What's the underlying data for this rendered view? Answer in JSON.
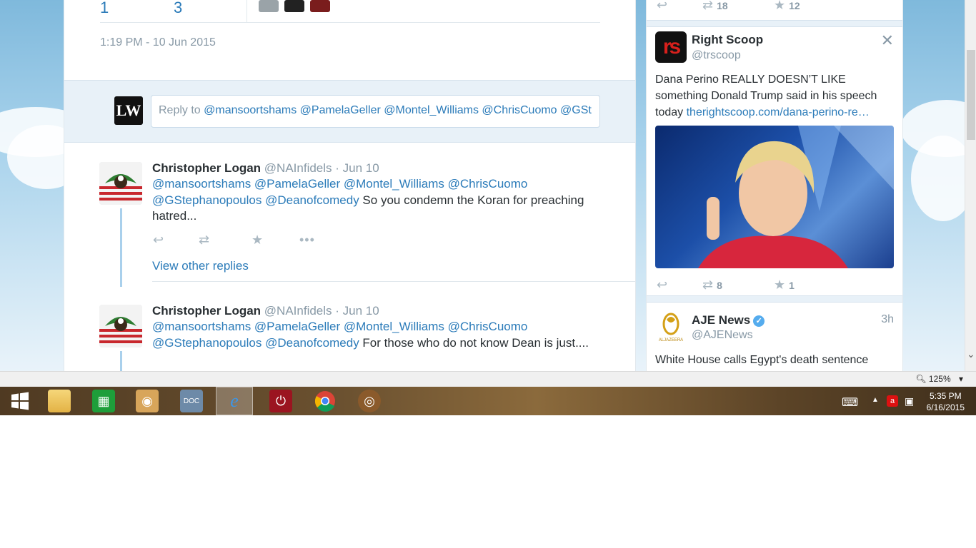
{
  "tweet_detail": {
    "counts": {
      "first": "1",
      "second": "3"
    },
    "timestamp": "1:19 PM - 10 Jun 2015"
  },
  "reply": {
    "avatar_text": "LW",
    "prefix": "Reply to ",
    "mentions": "@mansoortshams @PamelaGeller @Montel_Williams @ChrisCuomo @GSt"
  },
  "replies": [
    {
      "name": "Christopher Logan",
      "handle": "@NAInfidels",
      "date": "· Jun 10",
      "mentions_line1": "@mansoortshams @PamelaGeller @Montel_Williams @ChrisCuomo",
      "mentions_line2": "@GStephanopoulos @Deanofcomedy",
      "text": " So you condemn the Koran for preaching hatred...",
      "view_replies": "View other replies"
    },
    {
      "name": "Christopher Logan",
      "handle": "@NAInfidels",
      "date": "· Jun 10",
      "mentions_line1": "@mansoortshams @PamelaGeller @Montel_Williams @ChrisCuomo",
      "mentions_line2": "@GStephanopoulos @Deanofcomedy",
      "text": " For those who do not know Dean is just...."
    }
  ],
  "sidebar": {
    "top_actions": {
      "retweets": "18",
      "favorites": "12"
    },
    "card1": {
      "name": "Right Scoop",
      "handle": "@trscoop",
      "logo_text": "rs",
      "text": "Dana Perino REALLY DOESN’T LIKE something Donald Trump said in his speech today ",
      "link": "therightscoop.com/dana-perino-re…",
      "retweets": "8",
      "favorites": "1"
    },
    "card2": {
      "name": "AJE News",
      "handle": "@AJENews",
      "time": "3h",
      "text": "White House calls Egypt's death sentence",
      "logo_caption": "ALJAZEERA"
    }
  },
  "browser": {
    "zoom": "125%"
  },
  "taskbar": {
    "time": "5:35 PM",
    "date": "6/16/2015"
  },
  "colors": {
    "link": "#2b7bb9",
    "taskbar": "#6b5130",
    "reply_bg": "#e8f1f8"
  }
}
